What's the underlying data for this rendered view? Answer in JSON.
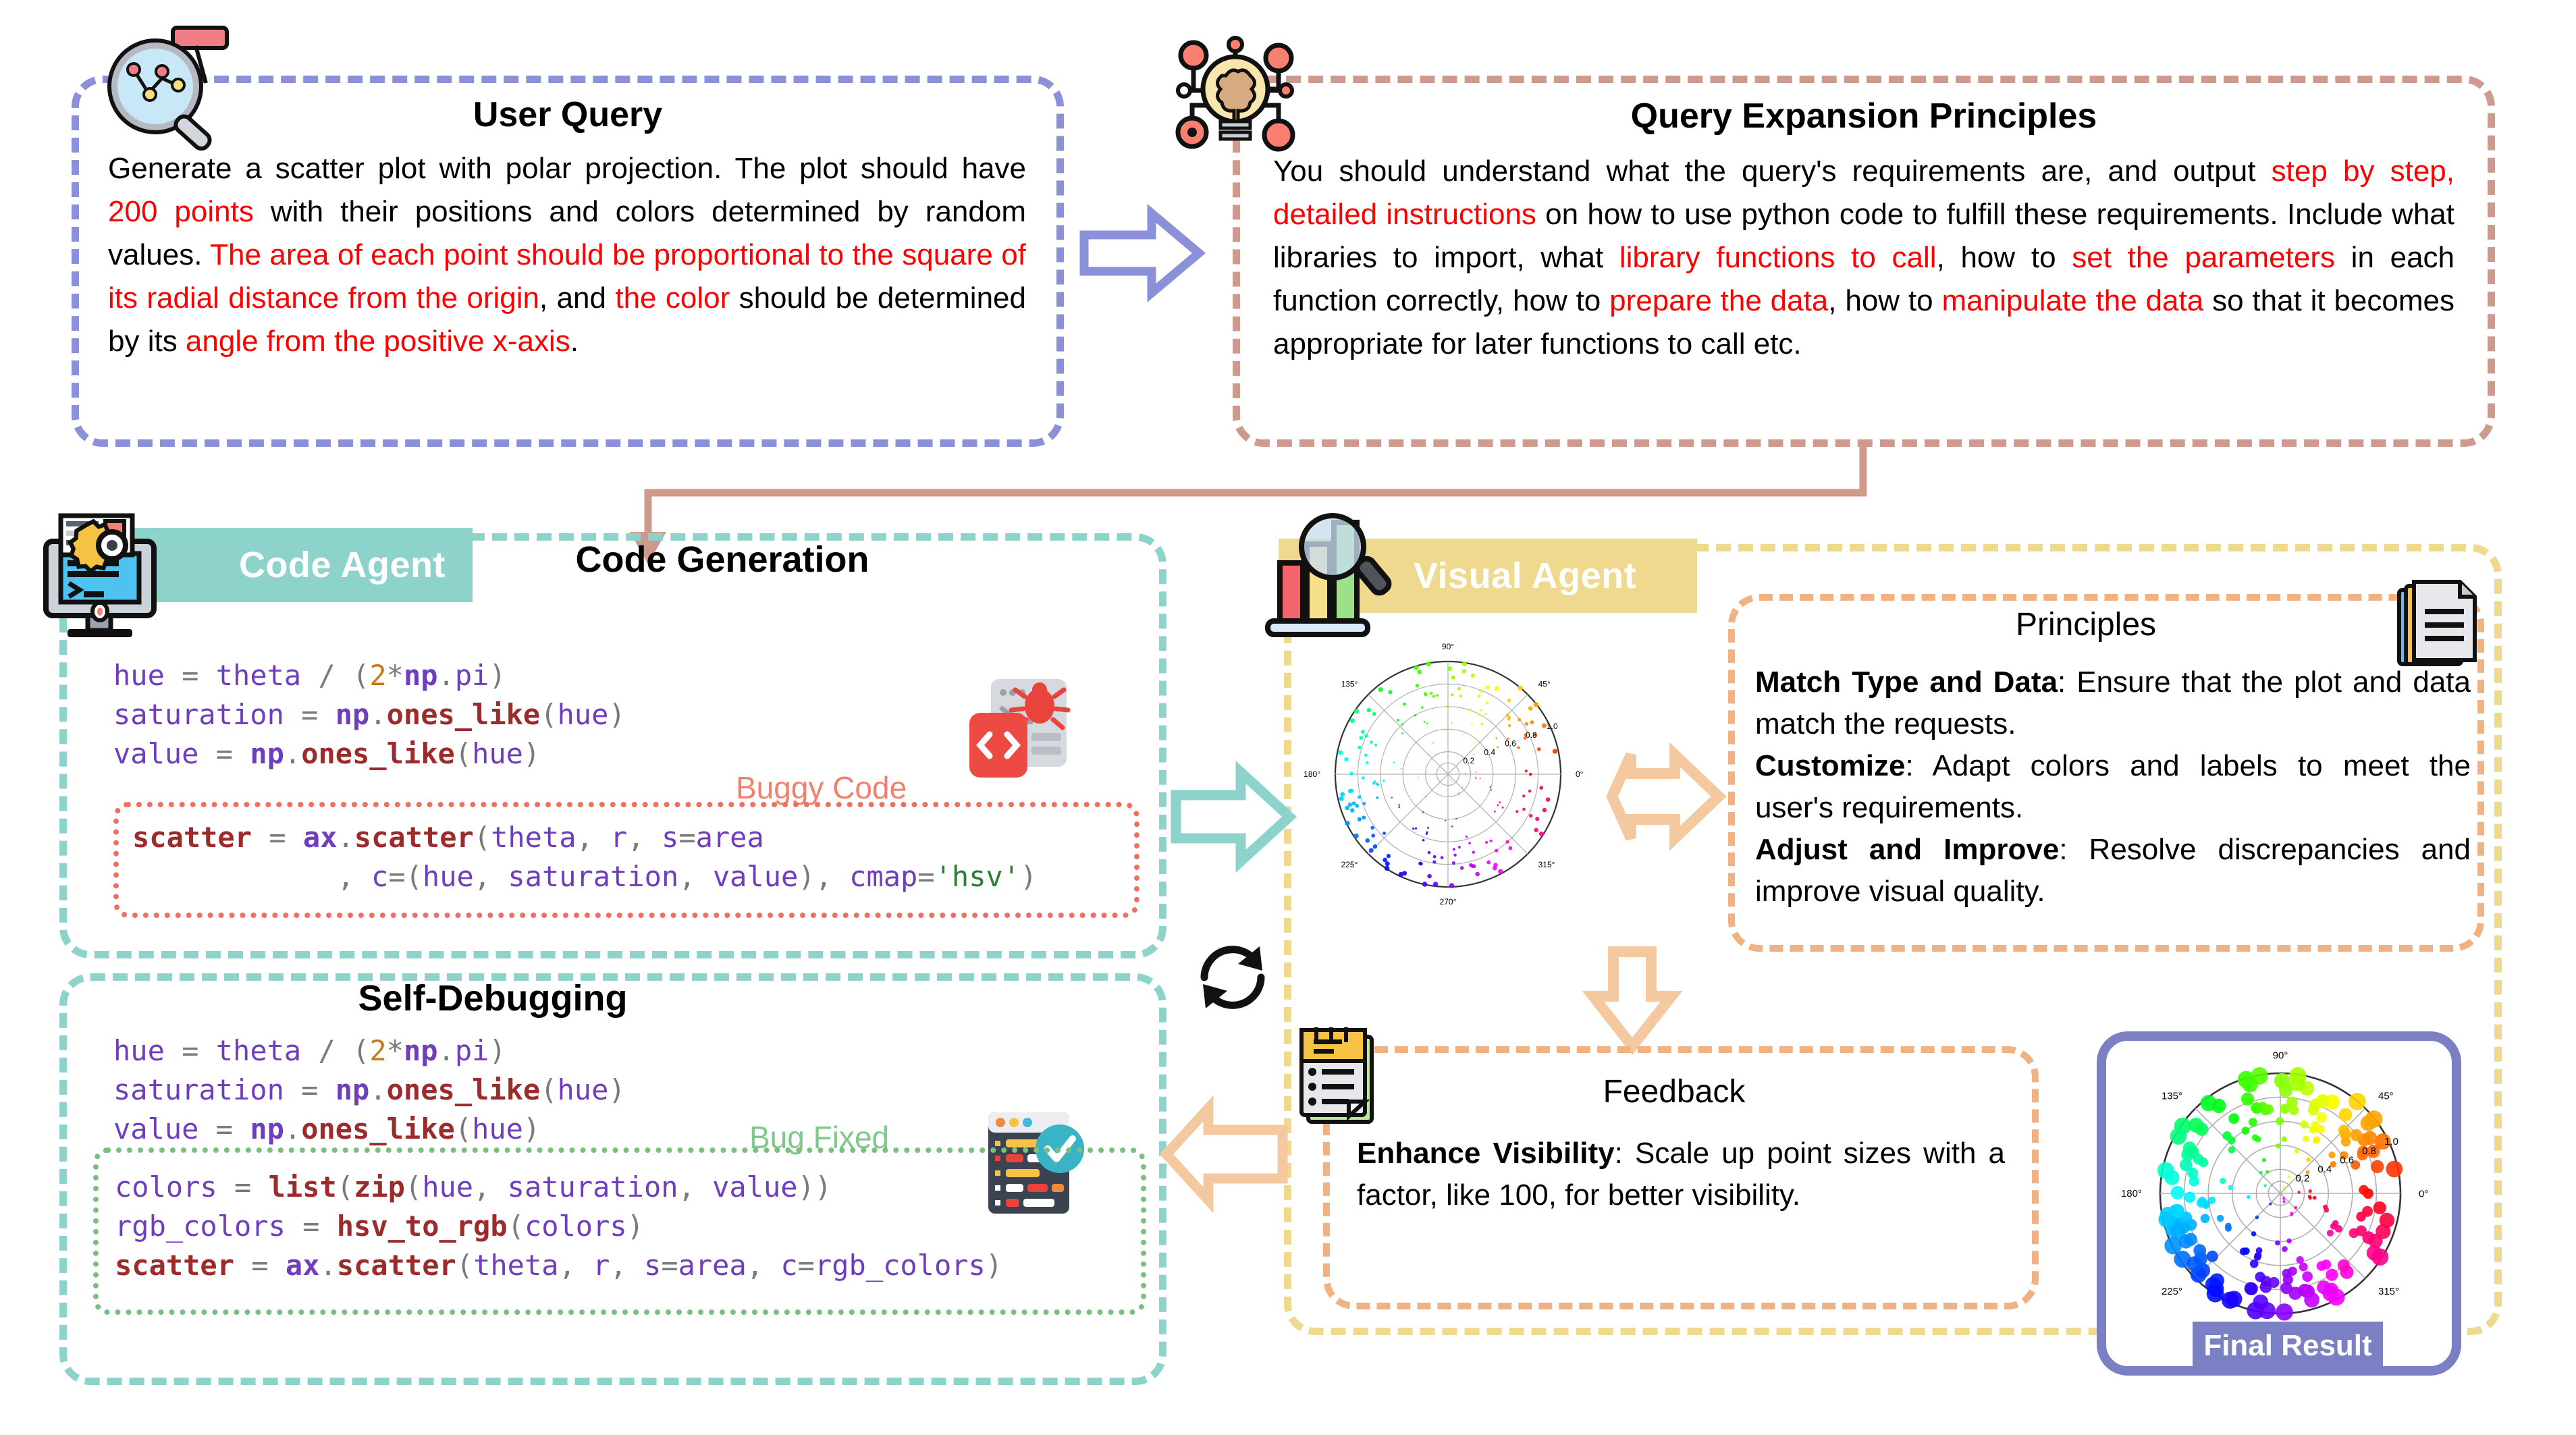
{
  "user_query": {
    "title": "User Query",
    "icon": "magnifier-chart-icon",
    "text_parts": [
      {
        "t": "Generate a scatter plot with polar projection. The plot should have ",
        "hl": false
      },
      {
        "t": "200 points",
        "hl": true
      },
      {
        "t": " with their positions and colors determined by random values. ",
        "hl": false
      },
      {
        "t": "The area of each point should be proportional to the square of its radial distance from the origin",
        "hl": true
      },
      {
        "t": ", and ",
        "hl": false
      },
      {
        "t": "the color",
        "hl": true
      },
      {
        "t": " should be determined by its ",
        "hl": false
      },
      {
        "t": "angle from the positive x-axis",
        "hl": true
      },
      {
        "t": ".",
        "hl": false
      }
    ],
    "border_color": "#8b91d8"
  },
  "query_expansion": {
    "title": "Query Expansion Principles",
    "icon": "brain-bulb-icon",
    "text_parts": [
      {
        "t": "You should understand what the query's requirements are, and output ",
        "hl": false
      },
      {
        "t": "step by step, detailed instructions",
        "hl": true
      },
      {
        "t": " on how to use python code to fulfill these requirements. Include what libraries to import, what ",
        "hl": false
      },
      {
        "t": "library functions to call",
        "hl": true
      },
      {
        "t": ", how to ",
        "hl": false
      },
      {
        "t": "set the parameters",
        "hl": true
      },
      {
        "t": " in each function correctly, how to ",
        "hl": false
      },
      {
        "t": "prepare the data",
        "hl": true
      },
      {
        "t": ", how to ",
        "hl": false
      },
      {
        "t": "manipulate the data",
        "hl": true
      },
      {
        "t": " so that it becomes appropriate for later functions to call etc.",
        "hl": false
      }
    ],
    "border_color": "#cf9a8e"
  },
  "code_agent": {
    "badge_label": "Code Agent",
    "badge_color": "#8dd3cb",
    "badge_icon": "monitor-gear-code-icon",
    "border_color": "#8dd3cb",
    "code_generation": {
      "title": "Code Generation",
      "tag": "Buggy Code",
      "tag_color": "#f08070",
      "icon": "bug-code-icon",
      "lines": [
        "hue = theta / (2*np.pi)",
        "saturation = np.ones_like(hue)",
        "value = np.ones_like(hue)"
      ],
      "highlight_lines": [
        "scatter = ax.scatter(theta, r, s=area",
        "            , c=(hue, saturation, value), cmap='hsv')"
      ],
      "highlight_border": "#ef7060"
    },
    "self_debugging": {
      "title": "Self-Debugging",
      "tag": "Bug Fixed",
      "tag_color": "#7fc98a",
      "icon": "checked-code-icon",
      "lines": [
        "hue = theta / (2*np.pi)",
        "saturation = np.ones_like(hue)",
        "value = np.ones_like(hue)"
      ],
      "highlight_lines": [
        "colors = list(zip(hue, saturation, value))",
        "rgb_colors = hsv_to_rgb(colors)",
        "scatter = ax.scatter(theta, r, s=area, c=rgb_colors)"
      ],
      "highlight_border": "#79bf7e"
    },
    "loop_icon": "refresh-loop-icon"
  },
  "visual_agent": {
    "badge_label": "Visual Agent",
    "badge_color": "#efd98e",
    "badge_icon": "barchart-magnifier-icon",
    "border_color": "#efd98e",
    "principles": {
      "title": "Principles",
      "icon": "documents-icon",
      "border_color": "#f0b183",
      "items": [
        {
          "label": "Match Type and Data",
          "text": ": Ensure that the plot and data match the requests."
        },
        {
          "label": "Customize",
          "text": ": Adapt colors and labels to meet the user's requirements."
        },
        {
          "label": "Adjust and Improve",
          "text": ": Resolve discrepancies and improve visual quality."
        }
      ]
    },
    "feedback": {
      "title": "Feedback",
      "icon": "notepad-list-icon",
      "border_color": "#f0b183",
      "items": [
        {
          "label": "Enhance Visibility",
          "text": ": Scale up point sizes with a factor, like 100, for better visibility."
        }
      ]
    }
  },
  "final_result": {
    "label": "Final Result",
    "frame_color": "#7b7fc4"
  },
  "arrows": {
    "query_to_expansion": {
      "name": "arrow-right-query-to-expansion",
      "color": "#8b91d8"
    },
    "codegen_to_visual": {
      "name": "arrow-right-codegen-to-visual",
      "color": "#8dd3cb"
    },
    "plot_to_principles": {
      "name": "arrow-bidirectional-plot-principles",
      "color": "#f5c9a0"
    },
    "principles_to_feedback": {
      "name": "arrow-down-principles-to-feedback",
      "color": "#f5c9a0"
    },
    "feedback_to_debug": {
      "name": "arrow-left-feedback-to-debug",
      "color": "#f5c9a0"
    },
    "expansion_to_agents": {
      "name": "connector-expansion-to-agents",
      "color": "#cf9a8e"
    }
  },
  "chart_data": [
    {
      "id": "visual-agent-preview-plot",
      "type": "scatter",
      "projection": "polar",
      "title": "",
      "n_points": 200,
      "marker_scale": "small (buggy: s=area, un-scaled)",
      "r_ticks": [
        0.2,
        0.4,
        0.6,
        0.8,
        1.0
      ],
      "theta_ticks": [
        "0°",
        "45°",
        "90°",
        "135°",
        "180°",
        "225°",
        "270°",
        "315°"
      ],
      "rlim": [
        0,
        1.0
      ],
      "colormap": "hsv",
      "color_by": "theta",
      "size_by": "r^2",
      "grid": true,
      "legend": "none"
    },
    {
      "id": "final-result-plot",
      "type": "scatter",
      "projection": "polar",
      "title": "",
      "n_points": 200,
      "marker_scale": "large (fixed: s=area scaled by 100)",
      "r_ticks": [
        0.2,
        0.4,
        0.6,
        0.8,
        1.0
      ],
      "theta_ticks": [
        "0°",
        "45°",
        "90°",
        "135°",
        "180°",
        "225°",
        "270°",
        "315°"
      ],
      "rlim": [
        0,
        1.0
      ],
      "colormap": "hsv",
      "color_by": "theta",
      "size_by": "r^2",
      "grid": true,
      "legend": "none"
    }
  ]
}
